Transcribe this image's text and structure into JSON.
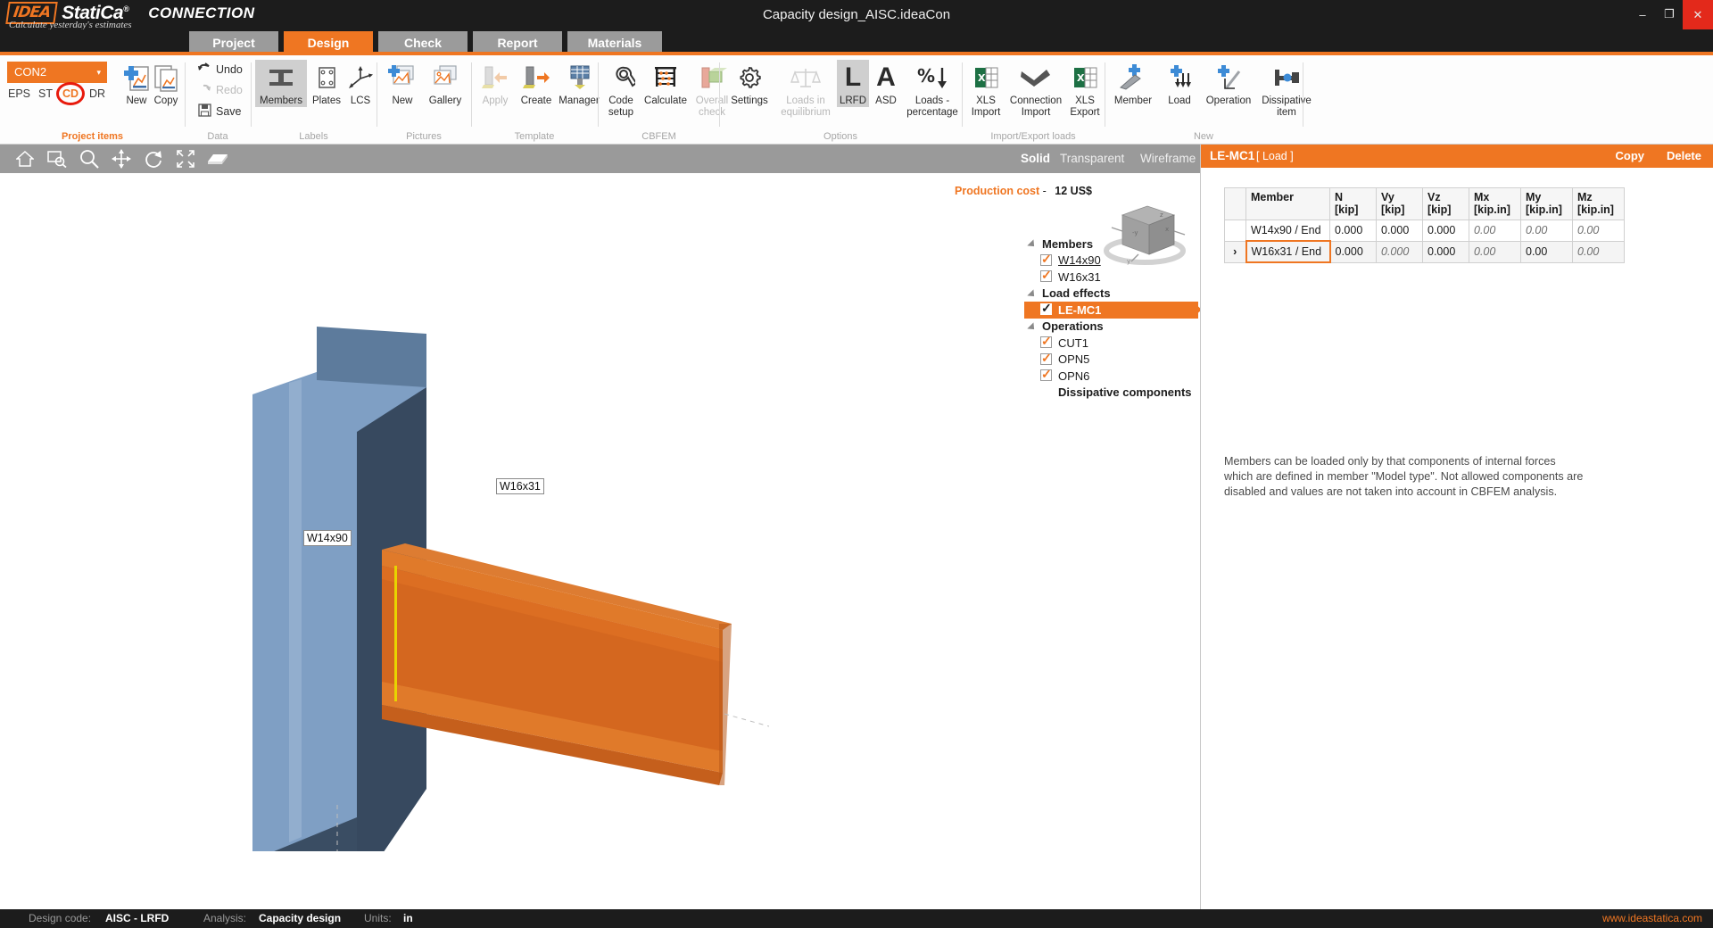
{
  "titlebar": {
    "logo": "IDEA",
    "statica": "StatiCa",
    "sup": "®",
    "product": "CONNECTION",
    "tagline": "Calculate yesterday's estimates",
    "document_title": "Capacity design_AISC.ideaCon",
    "minimize": "–",
    "maximize": "❐",
    "close": "✕"
  },
  "tabs": [
    {
      "label": "Project",
      "active": false
    },
    {
      "label": "Design",
      "active": true
    },
    {
      "label": "Check",
      "active": false
    },
    {
      "label": "Report",
      "active": false
    },
    {
      "label": "Materials",
      "active": false
    }
  ],
  "ribbon": {
    "groups": [
      {
        "label": "Project items",
        "accent": true
      },
      {
        "label": "Data",
        "accent": false
      },
      {
        "label": "Labels",
        "accent": false
      },
      {
        "label": "Pictures",
        "accent": false
      },
      {
        "label": "Template",
        "accent": false
      },
      {
        "label": "CBFEM",
        "accent": false
      },
      {
        "label": "Options",
        "accent": false
      },
      {
        "label": "Import/Export loads",
        "accent": false
      },
      {
        "label": "New",
        "accent": false
      }
    ],
    "project_items": {
      "combo_value": "CON2",
      "caret": "▾",
      "items": [
        {
          "label": "EPS",
          "current": false
        },
        {
          "label": "ST",
          "current": false
        },
        {
          "label": "CD",
          "current": true
        },
        {
          "label": "DR",
          "current": false
        }
      ],
      "new_label": "New",
      "copy_label": "Copy"
    },
    "data": {
      "undo": "Undo",
      "redo": "Redo",
      "save": "Save"
    },
    "labels": {
      "members": "Members",
      "plates": "Plates",
      "lcs": "LCS"
    },
    "pictures": {
      "new": "New",
      "gallery": "Gallery"
    },
    "template": {
      "apply": "Apply",
      "create": "Create",
      "manager": "Manager"
    },
    "cbfem": {
      "code_setup": "Code\nsetup",
      "code_setup_l1": "Code",
      "code_setup_l2": "setup",
      "calculate": "Calculate",
      "overall_l1": "Overall",
      "overall_l2": "check"
    },
    "options": {
      "settings": "Settings",
      "loads_eq_l1": "Loads in",
      "loads_eq_l2": "equilibrium",
      "lrfd": "LRFD",
      "asd": "ASD",
      "loads_pct_l1": "Loads -",
      "loads_pct_l2": "percentage"
    },
    "importexport": {
      "xls_import_l1": "XLS",
      "xls_import_l2": "Import",
      "conn_import_l1": "Connection",
      "conn_import_l2": "Import",
      "xls_export_l1": "XLS",
      "xls_export_l2": "Export"
    },
    "new": {
      "member": "Member",
      "load": "Load",
      "operation": "Operation",
      "dissipative_l1": "Dissipative",
      "dissipative_l2": "item"
    }
  },
  "viewbar": {
    "icons": [
      "home-icon",
      "zoom-window-icon",
      "zoom-icon",
      "pan-icon",
      "rotate-icon",
      "fit-icon",
      "view-solid-icon"
    ],
    "modes": [
      {
        "label": "Solid",
        "active": true
      },
      {
        "label": "Transparent",
        "active": false
      },
      {
        "label": "Wireframe",
        "active": false
      }
    ]
  },
  "viewport": {
    "production_cost_label": "Production cost",
    "production_cost_dash": "-",
    "production_cost_value": "12 US$",
    "model_labels": [
      {
        "text": "W14x90"
      },
      {
        "text": "W16x31"
      }
    ],
    "tree": [
      {
        "type": "group",
        "label": "Members"
      },
      {
        "type": "leaf",
        "label": "W14x90",
        "checked": true,
        "underline": true
      },
      {
        "type": "leaf",
        "label": "W16x31",
        "checked": true,
        "underline": false
      },
      {
        "type": "group",
        "label": "Load effects"
      },
      {
        "type": "leaf",
        "label": "LE-MC1",
        "checked": true,
        "selected": true
      },
      {
        "type": "group",
        "label": "Operations"
      },
      {
        "type": "leaf",
        "label": "CUT1",
        "checked": true
      },
      {
        "type": "leaf",
        "label": "OPN5",
        "checked": true
      },
      {
        "type": "leaf",
        "label": "OPN6",
        "checked": true
      },
      {
        "type": "bold-leaf",
        "label": "Dissipative components"
      }
    ],
    "colors": {
      "column": "#7f9fc4",
      "column_dark": "#37495f",
      "beam": "#d4671f",
      "weld": "#e8d400"
    }
  },
  "right_panel": {
    "header": {
      "name": "LE-MC1",
      "sub": "[ Load ]",
      "copy": "Copy",
      "delete": "Delete"
    },
    "table": {
      "columns": [
        {
          "l1": "",
          "l2": ""
        },
        {
          "l1": "Member",
          "l2": ""
        },
        {
          "l1": "N",
          "l2": "[kip]"
        },
        {
          "l1": "Vy",
          "l2": "[kip]"
        },
        {
          "l1": "Vz",
          "l2": "[kip]"
        },
        {
          "l1": "Mx",
          "l2": "[kip.in]"
        },
        {
          "l1": "My",
          "l2": "[kip.in]"
        },
        {
          "l1": "Mz",
          "l2": "[kip.in]"
        }
      ],
      "rows": [
        {
          "expander": "",
          "selected": false,
          "member": "W14x90 / End",
          "cells": [
            {
              "v": "0.000",
              "dim": false
            },
            {
              "v": "0.000",
              "dim": false
            },
            {
              "v": "0.000",
              "dim": false
            },
            {
              "v": "0.00",
              "dim": true
            },
            {
              "v": "0.00",
              "dim": true
            },
            {
              "v": "0.00",
              "dim": true
            }
          ]
        },
        {
          "expander": "›",
          "selected": true,
          "member": "W16x31 / End",
          "cells": [
            {
              "v": "0.000",
              "dim": false
            },
            {
              "v": "0.000",
              "dim": true
            },
            {
              "v": "0.000",
              "dim": false
            },
            {
              "v": "0.00",
              "dim": true
            },
            {
              "v": "0.00",
              "dim": false
            },
            {
              "v": "0.00",
              "dim": true
            }
          ]
        }
      ]
    },
    "note": "Members can be loaded only by that components of internal forces which are defined in member \"Model type\". Not allowed components are disabled and values are not taken into account in CBFEM analysis."
  },
  "statusbar": {
    "design_code_key": "Design code:",
    "design_code_value": "AISC - LRFD",
    "analysis_key": "Analysis:",
    "analysis_value": "Capacity design",
    "units_key": "Units:",
    "units_value": "in",
    "url": "www.ideastatica.com"
  },
  "theme": {
    "accent": "#ef7622",
    "dark": "#1c1c1c",
    "grey": "#9a9a9a",
    "red_ring": "#e81a0c"
  }
}
